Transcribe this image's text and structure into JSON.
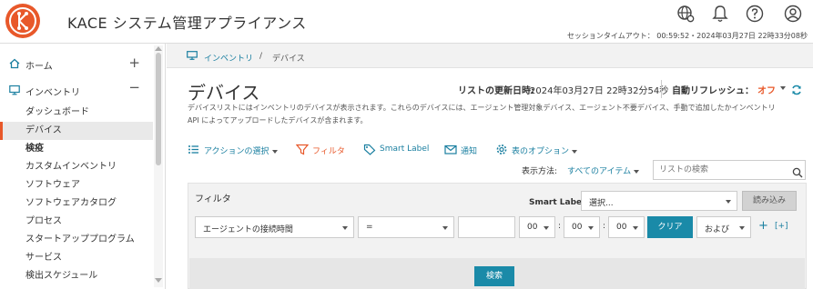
{
  "header": {
    "title": "KACE システム管理アプライアンス",
    "session_text": "セッションタイムアウト： 00:59:52・2024年03月27日 22時33分08秒",
    "icons": [
      "globe-settings-icon",
      "bell-icon",
      "help-icon",
      "user-icon"
    ]
  },
  "sidebar": {
    "home_label": "ホーム",
    "inventory_label": "インベントリ",
    "items": [
      {
        "label": "ダッシュボード"
      },
      {
        "label": "デバイス"
      },
      {
        "label": "検疫"
      },
      {
        "label": "カスタムインベントリ"
      },
      {
        "label": "ソフトウェア"
      },
      {
        "label": "ソフトウェアカタログ"
      },
      {
        "label": "プロセス"
      },
      {
        "label": "スタートアッププログラム"
      },
      {
        "label": "サービス"
      },
      {
        "label": "検出スケジュール"
      }
    ]
  },
  "breadcrumb": {
    "part1": "インベントリ",
    "separator": "/",
    "part2": "デバイス"
  },
  "page": {
    "title": "デバイス",
    "updated_label": "リストの更新日時:",
    "updated_value": "2024年03月27日 22時32分54秒",
    "auto_refresh_label": "自動リフレッシュ：",
    "auto_refresh_value": "オフ",
    "description_line1": "デバイスリストにはインベントリのデバイスが表示されます。これらのデバイスには、エージェント管理対象デバイス、エージェント不要デバイス、手動で追加したかインベントリ",
    "description_line2": "API によってアップロードしたデバイスが含まれます。"
  },
  "toolbar": {
    "actions_label": "アクションの選択",
    "filter_label": "フィルタ",
    "smart_label": "Smart Label",
    "notify_label": "通知",
    "table_options_label": "表のオプション",
    "view_label": "表示方法:",
    "view_value": "すべてのアイテム",
    "search_placeholder": "リストの検索"
  },
  "filter": {
    "title": "フィルタ",
    "smart_label_label": "Smart Label:",
    "smart_label_value": "選択...",
    "load_button": "読み込み",
    "field_value": "エージェントの接続時間",
    "operator_value": "=",
    "value_input": "",
    "hour_value": "00",
    "minute_value": "00",
    "second_value": "00",
    "time_separator": ":",
    "clear_button": "クリア",
    "conjunction_value": "および",
    "add_label": "+",
    "group_label": "[+]",
    "search_button": "検索"
  },
  "colors": {
    "accent": "#e8582a",
    "link": "#1a7fa0",
    "primary_button": "#1a8aa8"
  }
}
